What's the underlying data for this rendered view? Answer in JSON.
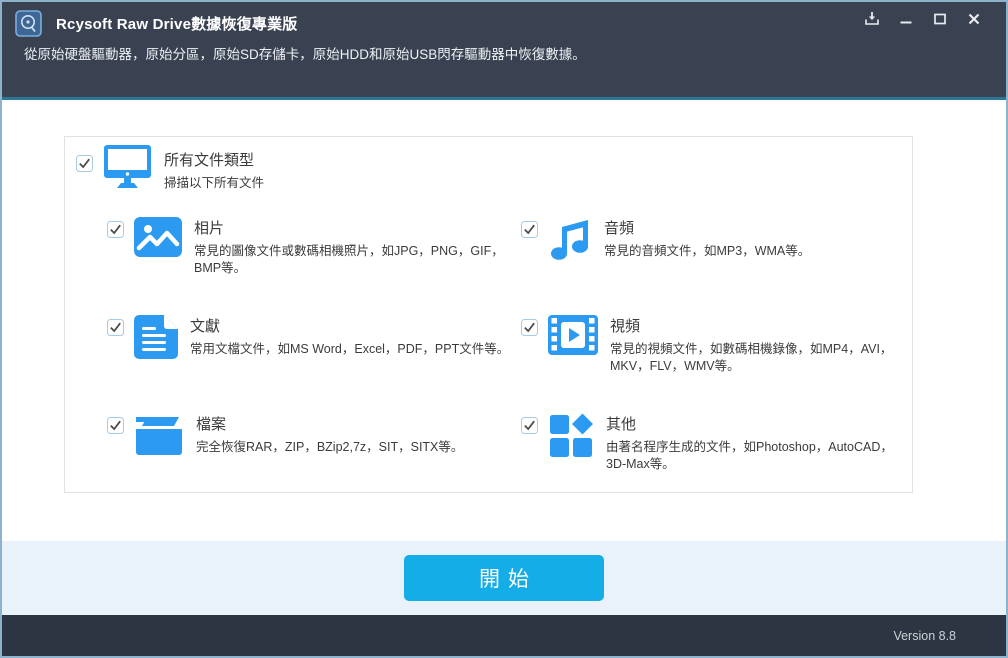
{
  "window": {
    "title": "Rcysoft Raw Drive數據恢復專業版",
    "subtitle": "從原始硬盤驅動器，原始分區，原始SD存儲卡，原始HDD和原始USB閃存驅動器中恢復數據。",
    "controls": [
      "download-icon",
      "minimize-icon",
      "maximize-icon",
      "close-icon"
    ]
  },
  "colors": {
    "titlebar_bg": "#3a4252",
    "accent_line": "#2d7795",
    "icon_blue": "#2b9af0",
    "strip_bg": "#e9f2fb",
    "footer_bg": "#2c3541",
    "start_button_bg": "#15ade7",
    "checkbox_border": "#a5cbe6"
  },
  "all_files": {
    "label": "所有文件類型",
    "description": "掃描以下所有文件",
    "icon": "monitor-icon",
    "checked": true
  },
  "file_types": [
    {
      "label": "相片",
      "description": "常見的圖像文件或數碼相機照片，如JPG，PNG，GIF，BMP等。",
      "icon": "photo-icon",
      "checked": true
    },
    {
      "label": "音頻",
      "description": "常見的音頻文件，如MP3，WMA等。",
      "icon": "music-note-icon",
      "checked": true
    },
    {
      "label": "文獻",
      "description": "常用文檔文件，如MS Word，Excel，PDF，PPT文件等。",
      "icon": "document-icon",
      "checked": true
    },
    {
      "label": "視頻",
      "description": "常見的視頻文件，如數碼相機錄像，如MP4，AVI，MKV，FLV，WMV等。",
      "icon": "video-icon",
      "checked": true
    },
    {
      "label": "檔案",
      "description": "完全恢復RAR，ZIP，BZip2,7z，SIT，SITX等。",
      "icon": "open-folder-icon",
      "checked": true
    },
    {
      "label": "其他",
      "description": "由著名程序生成的文件，如Photoshop，AutoCAD，3D-Max等。",
      "icon": "shapes-grid-icon",
      "checked": true
    }
  ],
  "start_button": {
    "label": "開始"
  },
  "footer": {
    "version": "Version 8.8"
  }
}
